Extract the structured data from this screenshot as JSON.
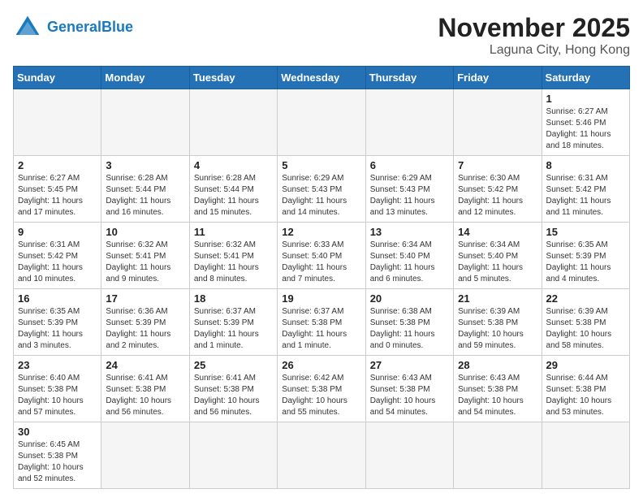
{
  "header": {
    "logo_general": "General",
    "logo_blue": "Blue",
    "month": "November 2025",
    "location": "Laguna City, Hong Kong"
  },
  "weekdays": [
    "Sunday",
    "Monday",
    "Tuesday",
    "Wednesday",
    "Thursday",
    "Friday",
    "Saturday"
  ],
  "weeks": [
    [
      {
        "day": "",
        "info": ""
      },
      {
        "day": "",
        "info": ""
      },
      {
        "day": "",
        "info": ""
      },
      {
        "day": "",
        "info": ""
      },
      {
        "day": "",
        "info": ""
      },
      {
        "day": "",
        "info": ""
      },
      {
        "day": "1",
        "info": "Sunrise: 6:27 AM\nSunset: 5:46 PM\nDaylight: 11 hours\nand 18 minutes."
      }
    ],
    [
      {
        "day": "2",
        "info": "Sunrise: 6:27 AM\nSunset: 5:45 PM\nDaylight: 11 hours\nand 17 minutes."
      },
      {
        "day": "3",
        "info": "Sunrise: 6:28 AM\nSunset: 5:44 PM\nDaylight: 11 hours\nand 16 minutes."
      },
      {
        "day": "4",
        "info": "Sunrise: 6:28 AM\nSunset: 5:44 PM\nDaylight: 11 hours\nand 15 minutes."
      },
      {
        "day": "5",
        "info": "Sunrise: 6:29 AM\nSunset: 5:43 PM\nDaylight: 11 hours\nand 14 minutes."
      },
      {
        "day": "6",
        "info": "Sunrise: 6:29 AM\nSunset: 5:43 PM\nDaylight: 11 hours\nand 13 minutes."
      },
      {
        "day": "7",
        "info": "Sunrise: 6:30 AM\nSunset: 5:42 PM\nDaylight: 11 hours\nand 12 minutes."
      },
      {
        "day": "8",
        "info": "Sunrise: 6:31 AM\nSunset: 5:42 PM\nDaylight: 11 hours\nand 11 minutes."
      }
    ],
    [
      {
        "day": "9",
        "info": "Sunrise: 6:31 AM\nSunset: 5:42 PM\nDaylight: 11 hours\nand 10 minutes."
      },
      {
        "day": "10",
        "info": "Sunrise: 6:32 AM\nSunset: 5:41 PM\nDaylight: 11 hours\nand 9 minutes."
      },
      {
        "day": "11",
        "info": "Sunrise: 6:32 AM\nSunset: 5:41 PM\nDaylight: 11 hours\nand 8 minutes."
      },
      {
        "day": "12",
        "info": "Sunrise: 6:33 AM\nSunset: 5:40 PM\nDaylight: 11 hours\nand 7 minutes."
      },
      {
        "day": "13",
        "info": "Sunrise: 6:34 AM\nSunset: 5:40 PM\nDaylight: 11 hours\nand 6 minutes."
      },
      {
        "day": "14",
        "info": "Sunrise: 6:34 AM\nSunset: 5:40 PM\nDaylight: 11 hours\nand 5 minutes."
      },
      {
        "day": "15",
        "info": "Sunrise: 6:35 AM\nSunset: 5:39 PM\nDaylight: 11 hours\nand 4 minutes."
      }
    ],
    [
      {
        "day": "16",
        "info": "Sunrise: 6:35 AM\nSunset: 5:39 PM\nDaylight: 11 hours\nand 3 minutes."
      },
      {
        "day": "17",
        "info": "Sunrise: 6:36 AM\nSunset: 5:39 PM\nDaylight: 11 hours\nand 2 minutes."
      },
      {
        "day": "18",
        "info": "Sunrise: 6:37 AM\nSunset: 5:39 PM\nDaylight: 11 hours\nand 1 minute."
      },
      {
        "day": "19",
        "info": "Sunrise: 6:37 AM\nSunset: 5:38 PM\nDaylight: 11 hours\nand 1 minute."
      },
      {
        "day": "20",
        "info": "Sunrise: 6:38 AM\nSunset: 5:38 PM\nDaylight: 11 hours\nand 0 minutes."
      },
      {
        "day": "21",
        "info": "Sunrise: 6:39 AM\nSunset: 5:38 PM\nDaylight: 10 hours\nand 59 minutes."
      },
      {
        "day": "22",
        "info": "Sunrise: 6:39 AM\nSunset: 5:38 PM\nDaylight: 10 hours\nand 58 minutes."
      }
    ],
    [
      {
        "day": "23",
        "info": "Sunrise: 6:40 AM\nSunset: 5:38 PM\nDaylight: 10 hours\nand 57 minutes."
      },
      {
        "day": "24",
        "info": "Sunrise: 6:41 AM\nSunset: 5:38 PM\nDaylight: 10 hours\nand 56 minutes."
      },
      {
        "day": "25",
        "info": "Sunrise: 6:41 AM\nSunset: 5:38 PM\nDaylight: 10 hours\nand 56 minutes."
      },
      {
        "day": "26",
        "info": "Sunrise: 6:42 AM\nSunset: 5:38 PM\nDaylight: 10 hours\nand 55 minutes."
      },
      {
        "day": "27",
        "info": "Sunrise: 6:43 AM\nSunset: 5:38 PM\nDaylight: 10 hours\nand 54 minutes."
      },
      {
        "day": "28",
        "info": "Sunrise: 6:43 AM\nSunset: 5:38 PM\nDaylight: 10 hours\nand 54 minutes."
      },
      {
        "day": "29",
        "info": "Sunrise: 6:44 AM\nSunset: 5:38 PM\nDaylight: 10 hours\nand 53 minutes."
      }
    ],
    [
      {
        "day": "30",
        "info": "Sunrise: 6:45 AM\nSunset: 5:38 PM\nDaylight: 10 hours\nand 52 minutes."
      },
      {
        "day": "",
        "info": ""
      },
      {
        "day": "",
        "info": ""
      },
      {
        "day": "",
        "info": ""
      },
      {
        "day": "",
        "info": ""
      },
      {
        "day": "",
        "info": ""
      },
      {
        "day": "",
        "info": ""
      }
    ]
  ]
}
